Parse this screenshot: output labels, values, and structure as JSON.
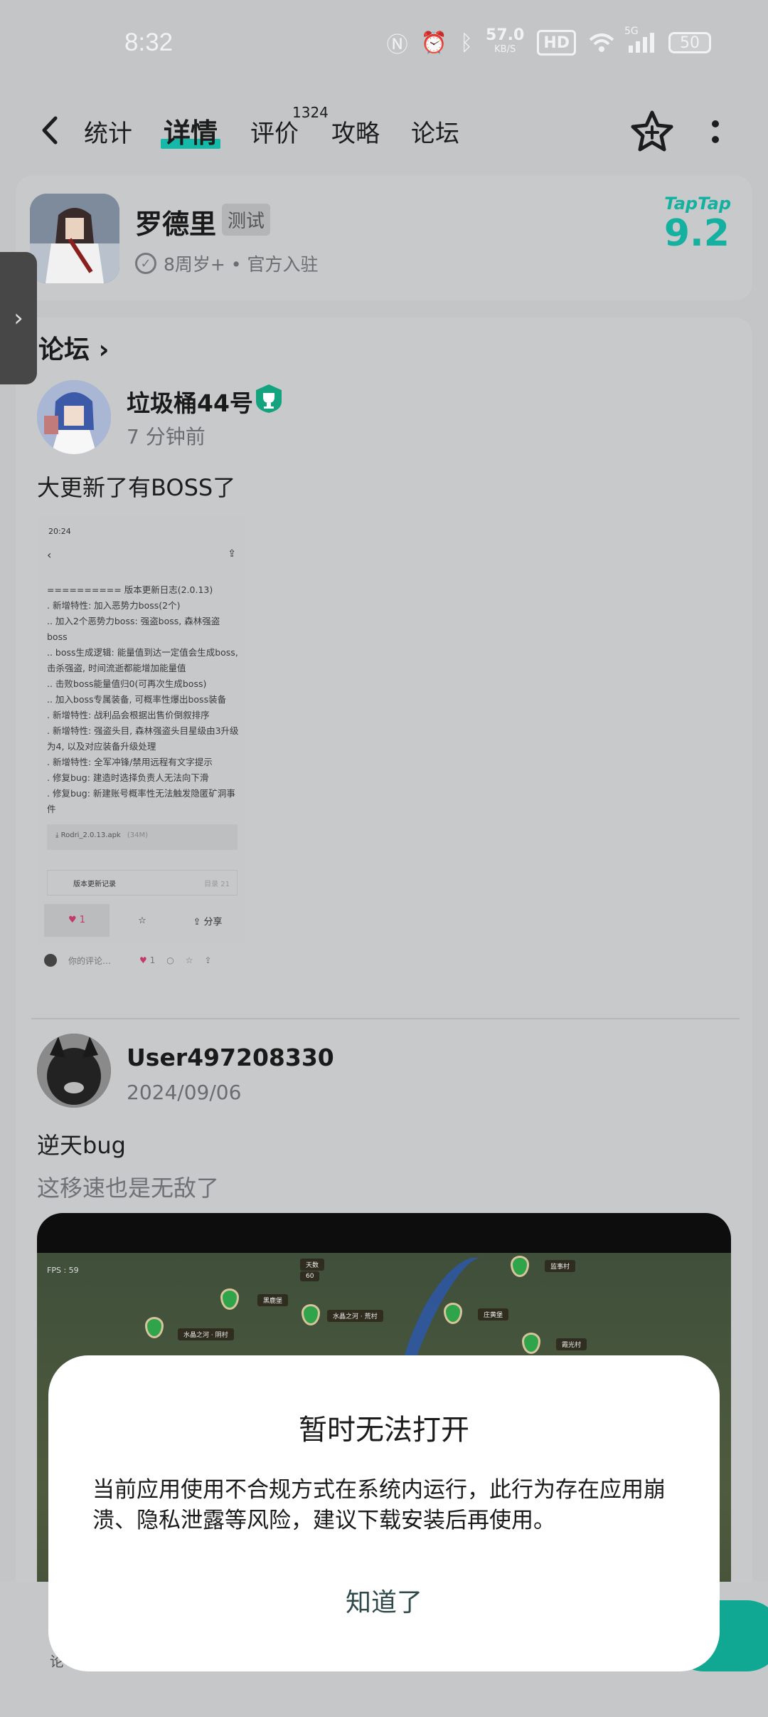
{
  "status_bar": {
    "time": "8:32",
    "speed_value": "57.0",
    "speed_unit": "KB/S",
    "hd": "HD",
    "network": "5G",
    "battery": "50"
  },
  "nav": {
    "tabs": [
      "统计",
      "详情",
      "评价",
      "攻略",
      "论坛"
    ],
    "active_tab": "详情",
    "review_badge": "1324",
    "accent": "#14b9a8"
  },
  "app": {
    "name": "罗德里",
    "tag": "测试",
    "meta": "8周岁+ • 官方入驻",
    "rating_brand": "TapTap",
    "rating": "9.2",
    "rating_color": "#14b0a0"
  },
  "forum": {
    "title": "论坛",
    "posts": [
      {
        "username": "垃圾桶44号",
        "time": "7 分钟前",
        "title": "大更新了有BOSS了",
        "image": {
          "time": "20:24",
          "log": "========== 版本更新日志(2.0.13)\n. 新增特性: 加入恶势力boss(2个)\n.. 加入2个恶势力boss: 强盗boss, 森林强盗boss\n.. boss生成逻辑: 能量值到达一定值会生成boss, 击杀强盗, 时间流逝都能增加能量值\n.. 击败boss能量值归0(可再次生成boss)\n.. 加入boss专属装备, 可概率性爆出boss装备\n. 新增特性: 战利品会根据出售价倒叙排序\n. 新增特性: 强盗头目, 森林强盗头目星级由3升级为4, 以及对应装备升级处理\n. 新增特性: 全军冲锋/禁用远程有文字提示\n. 修复bug: 建造时选择负责人无法向下滑\n. 修复bug: 新建账号概率性无法触发隐匿矿洞事件",
          "file": "Rodri_2.0.13.apk",
          "file_size": "(34M)",
          "record": "版本更新记录",
          "record_count": "目录 21",
          "like_count": "1",
          "share": "分享"
        },
        "footer": {
          "comment_placeholder": "你的评论…",
          "like_count": "1"
        }
      },
      {
        "username": "User497208330",
        "time": "2024/09/06",
        "title": "逆天bug",
        "subtitle": "这移速也是无敌了",
        "video": {
          "fps": "FPS : 59",
          "labels": [
            "天数",
            "60",
            "黑鹿堡",
            "水晶之河 · 荒村",
            "水晶之河 · 阴村",
            "庄黄堡",
            "监事村",
            "霞光村"
          ]
        }
      }
    ]
  },
  "dialog": {
    "title": "暂时无法打开",
    "body": "当前应用使用不合规方式在系统内运行，此行为存在应用崩溃、隐私泄露等风险，建议下载安装后再使用。",
    "button": "知道了"
  },
  "bottom": {
    "hint": "论"
  }
}
